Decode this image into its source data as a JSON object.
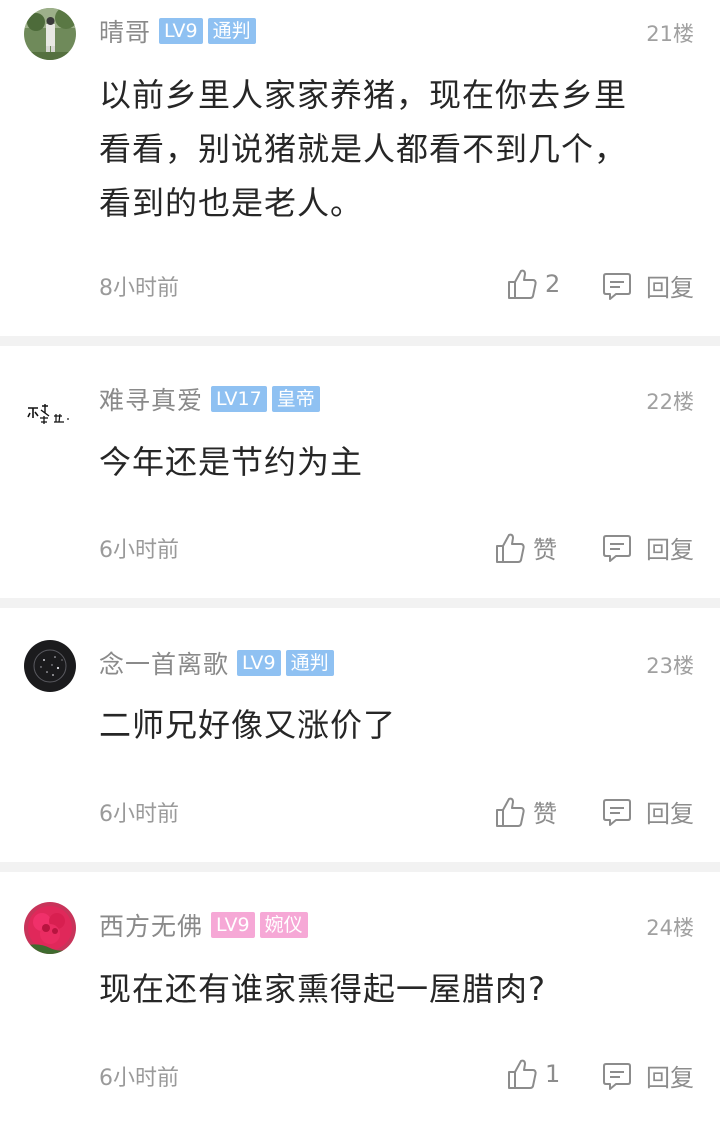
{
  "comments": [
    {
      "username": "晴哥",
      "level": "LV9",
      "title": "通判",
      "tag_color": "#8fc1f2",
      "floor": "21楼",
      "text_lines": [
        "以前乡里人家家养猪，现在你去乡里",
        "看看，别说猪就是人都看不到几个，",
        "看到的也是老人。"
      ],
      "time": "8小时前",
      "likes": "2",
      "reply_label": "回复",
      "avatar_icon": "person-outdoor-avatar"
    },
    {
      "username": "难寻真爱",
      "level": "LV17",
      "title": "皇帝",
      "tag_color": "#8fc1f2",
      "floor": "22楼",
      "text_lines": [
        "今年还是节约为主"
      ],
      "time": "6小时前",
      "likes": "赞",
      "reply_label": "回复",
      "avatar_icon": "calligraphy-avatar"
    },
    {
      "username": "念一首离歌",
      "level": "LV9",
      "title": "通判",
      "tag_color": "#8fc1f2",
      "floor": "23楼",
      "text_lines": [
        "二师兄好像又涨价了"
      ],
      "time": "6小时前",
      "likes": "赞",
      "reply_label": "回复",
      "avatar_icon": "starry-dark-avatar"
    },
    {
      "username": "西方无佛",
      "level": "LV9",
      "title": "婉仪",
      "tag_color": "#f6a8d6",
      "floor": "24楼",
      "text_lines": [
        "现在还有谁家熏得起一屋腊肉?"
      ],
      "time": "6小时前",
      "likes": "1",
      "reply_label": "回复",
      "avatar_icon": "red-flower-avatar"
    }
  ]
}
